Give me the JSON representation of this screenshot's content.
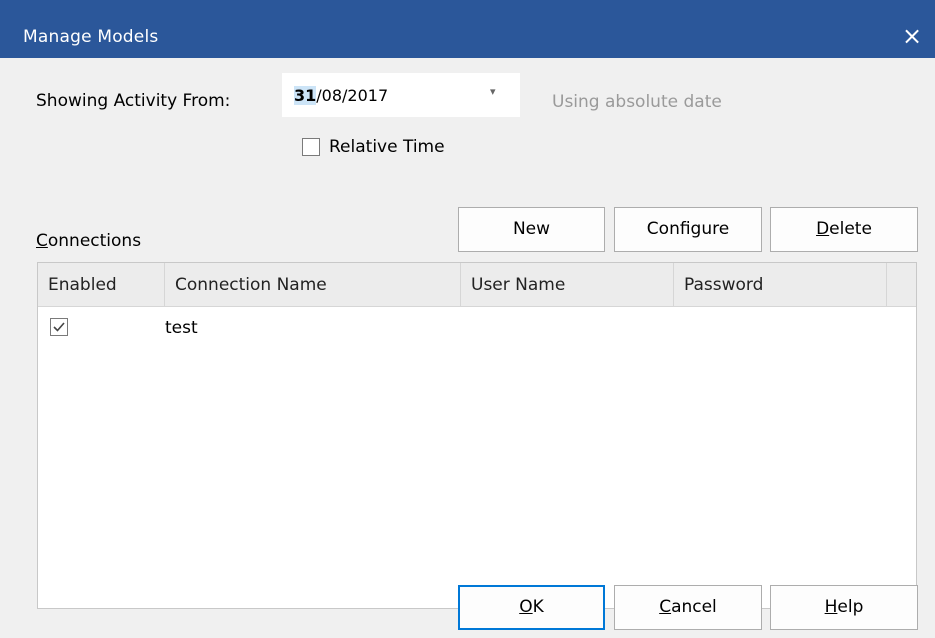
{
  "window": {
    "title": "Manage Models",
    "close": "×"
  },
  "activity": {
    "label": "Showing Activity From:",
    "date_selected": "31",
    "date_rest": "/08/2017",
    "dropdown_arrow": "▾",
    "hint": "Using absolute date",
    "relative_time_label": "Relative Time",
    "relative_time_checked": false
  },
  "connections": {
    "label_mnemonic": "C",
    "label_rest": "onnections",
    "buttons": {
      "new": "New",
      "configure": "Configure",
      "delete_mnemonic": "D",
      "delete_rest": "elete"
    },
    "columns": [
      "Enabled",
      "Connection Name",
      "User Name",
      "Password"
    ],
    "rows": [
      {
        "enabled": true,
        "connection_name": "test",
        "user_name": "",
        "password": ""
      }
    ]
  },
  "footer": {
    "ok_mnemonic": "O",
    "ok_rest": "K",
    "cancel_mnemonic": "C",
    "cancel_rest": "ancel",
    "help_mnemonic": "H",
    "help_rest": "elp"
  },
  "colors": {
    "titlebar": "#2b579a",
    "accent": "#0078d7",
    "hint": "#9a9a9a"
  }
}
